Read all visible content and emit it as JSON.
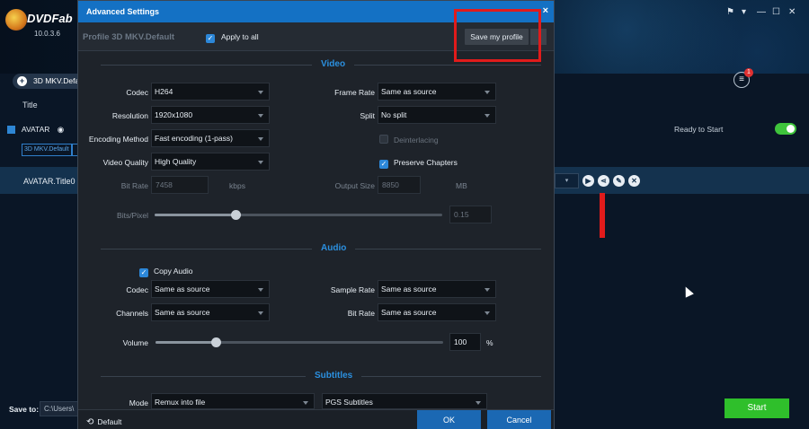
{
  "app": {
    "name": "DVDFab",
    "version": "10.0.3.6",
    "window_controls": [
      "⚑",
      "▾",
      "—",
      "☐",
      "✕"
    ],
    "profile_pill": "3D MKV.Defa",
    "title_column": "Title",
    "movie_title": "AVATAR",
    "chip1": "3D MKV.Default",
    "title0": "AVATAR.Title0",
    "save_to_label": "Save to:",
    "save_path": "C:\\Users\\",
    "queue_badge": "1",
    "ready_text": "Ready to Start",
    "start_label": "Start"
  },
  "dialog": {
    "title": "Advanced Settings",
    "close": "×",
    "profile_name": "Profile 3D MKV.Default",
    "apply_all": "Apply to all",
    "save_profile": "Save my profile",
    "video_section": "Video",
    "video": {
      "codec_label": "Codec",
      "codec": "H264",
      "resolution_label": "Resolution",
      "resolution": "1920x1080",
      "encoding_label": "Encoding Method",
      "encoding": "Fast encoding (1-pass)",
      "quality_label": "Video Quality",
      "quality": "High Quality",
      "bitrate_label": "Bit Rate",
      "bitrate": "7458",
      "bitrate_unit": "kbps",
      "bitspixel_label": "Bits/Pixel",
      "bitspixel": "0.15",
      "bitspixel_level": 0.28,
      "framerate_label": "Frame Rate",
      "framerate": "Same as source",
      "split_label": "Split",
      "split": "No split",
      "deinterlacing": "Deinterlacing",
      "preserve_chapters": "Preserve Chapters",
      "output_size_label": "Output Size",
      "output_size": "8850",
      "output_unit": "MB"
    },
    "audio_section": "Audio",
    "audio": {
      "copy_audio": "Copy Audio",
      "codec_label": "Codec",
      "codec": "Same as source",
      "channels_label": "Channels",
      "channels": "Same as source",
      "samplerate_label": "Sample Rate",
      "samplerate": "Same as source",
      "bitrate_label": "Bit Rate",
      "bitrate": "Same as source",
      "volume_label": "Volume",
      "volume": "100",
      "volume_unit": "%",
      "volume_level": 0.21
    },
    "subtitles_section": "Subtitles",
    "subtitles": {
      "mode_label": "Mode",
      "mode": "Remux into file",
      "format": "PGS Subtitles"
    },
    "default": "Default",
    "ok": "OK",
    "cancel": "Cancel"
  }
}
